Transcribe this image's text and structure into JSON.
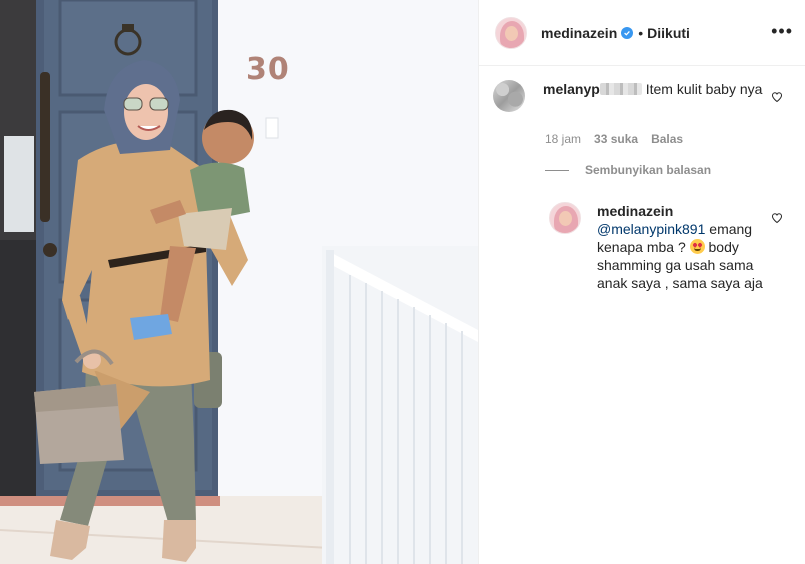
{
  "post": {
    "house_number": "30",
    "header": {
      "username": "medinazein",
      "follow_status": "Diikuti",
      "separator": "•",
      "more_icon": "more-horizontal-icon",
      "verified_icon": "verified-badge-icon"
    },
    "comments": [
      {
        "username_visible": "melanyp",
        "text": "Item kulit baby nya",
        "time": "18 jam",
        "likes": "33 suka",
        "reply_label": "Balas",
        "avatar_note": "blurred"
      }
    ],
    "hide_replies_label": "Sembunyikan balasan",
    "reply": {
      "username": "medinazein",
      "mention": "@melanypink891",
      "text_part1": " emang kenapa mba ? ",
      "emoji": "heart-eyes-emoji",
      "text_part2": " body shamming ga usah sama anak saya , sama saya aja"
    },
    "colors": {
      "door": "#566983",
      "wall": "#f4f6fa",
      "blouse": "#d6aa78",
      "pants": "#858a7a",
      "hijab": "#6e7f9f",
      "verified": "#3897f0",
      "mention": "#00376b",
      "muted": "#8e8e8e"
    }
  }
}
